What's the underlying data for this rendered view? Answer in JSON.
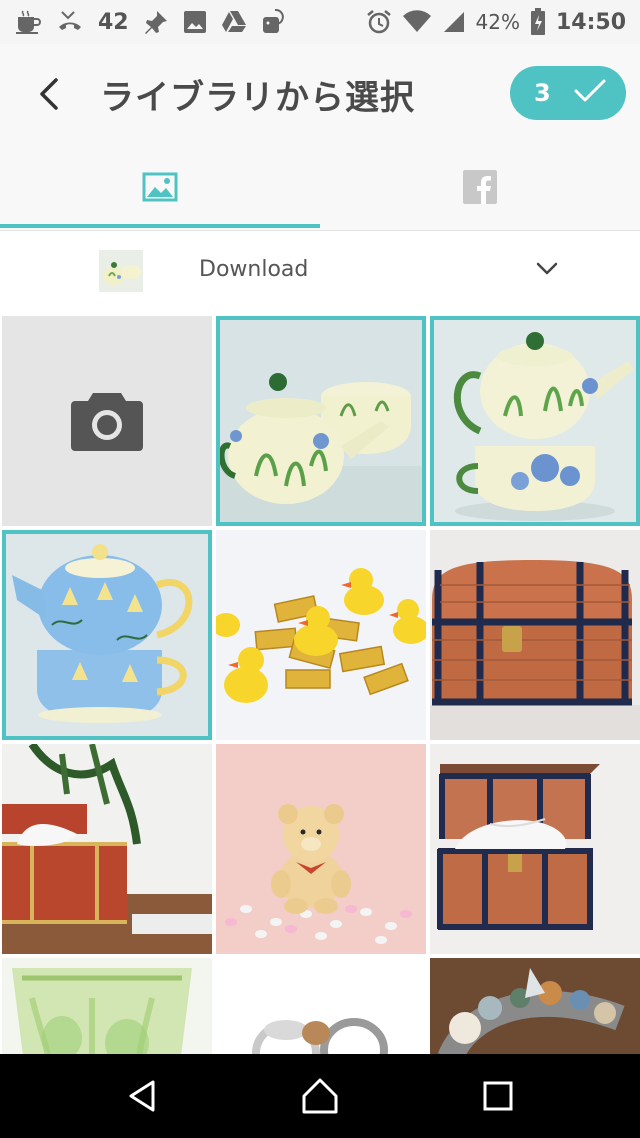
{
  "status_bar": {
    "notification_count": "42",
    "battery": "42%",
    "time": "14:50",
    "icons_left": [
      "cup-icon",
      "missed-call-icon",
      "pin-icon",
      "gallery-icon",
      "drive-icon",
      "android-update-icon"
    ],
    "icons_right": [
      "alarm-icon",
      "wifi-icon",
      "signal-icon",
      "battery-charging-icon"
    ]
  },
  "header": {
    "back_icon": "chevron-left-icon",
    "title": "ライブラリから選択",
    "selected_count": "3",
    "confirm_icon": "check-icon",
    "accent_color": "#4fc3c4"
  },
  "tabs": [
    {
      "name": "photos",
      "icon": "image-icon",
      "active": true
    },
    {
      "name": "facebook",
      "icon": "facebook-icon",
      "active": false
    }
  ],
  "album": {
    "name": "Download",
    "icon": "chevron-down-icon"
  },
  "grid": {
    "items": [
      {
        "kind": "camera",
        "selected": false
      },
      {
        "kind": "photo",
        "subject": "teapot-and-cup",
        "selected": true
      },
      {
        "kind": "photo",
        "subject": "stacked-teapot-green",
        "selected": true
      },
      {
        "kind": "photo",
        "subject": "stacked-teapot-blue",
        "selected": true
      },
      {
        "kind": "photo",
        "subject": "rubber-ducks-gold-bars",
        "selected": false
      },
      {
        "kind": "photo",
        "subject": "treasure-chest",
        "selected": false
      },
      {
        "kind": "photo",
        "subject": "tissue-box-chest",
        "selected": false
      },
      {
        "kind": "photo",
        "subject": "teddy-bear",
        "selected": false
      },
      {
        "kind": "photo",
        "subject": "chest-with-tissues",
        "selected": false
      },
      {
        "kind": "photo",
        "subject": "glass-cups",
        "selected": false
      },
      {
        "kind": "photo",
        "subject": "rings",
        "selected": false
      },
      {
        "kind": "photo",
        "subject": "crystals",
        "selected": false
      }
    ]
  },
  "nav_bar": {
    "back_icon": "triangle-back-icon",
    "home_icon": "home-icon",
    "recent_icon": "square-recent-icon"
  }
}
